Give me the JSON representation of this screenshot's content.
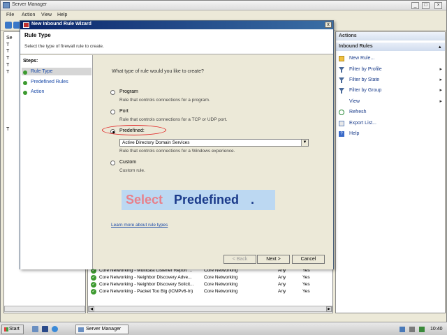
{
  "server_manager": {
    "title": "Server Manager",
    "menu": [
      "File",
      "Action",
      "View",
      "Help"
    ],
    "tree_fragments": [
      "Se",
      "T",
      "T",
      "T",
      "T",
      "T",
      "T"
    ],
    "list_rows": [
      {
        "name": "Core Networking - Multicast Listener Report ...",
        "group": "Core Networking",
        "profile": "Any",
        "enabled": "Yes"
      },
      {
        "name": "Core Networking - Neighbor Discovery Adve...",
        "group": "Core Networking",
        "profile": "Any",
        "enabled": "Yes"
      },
      {
        "name": "Core Networking - Neighbor Discovery Solicit...",
        "group": "Core Networking",
        "profile": "Any",
        "enabled": "Yes"
      },
      {
        "name": "Core Networking - Packet Too Big (ICMPv6-In)",
        "group": "Core Networking",
        "profile": "Any",
        "enabled": "Yes"
      }
    ]
  },
  "actions": {
    "title": "Actions",
    "section": "Inbound Rules",
    "items": [
      {
        "label": "New Rule...",
        "icon": "new-rule-icon",
        "submenu": false
      },
      {
        "label": "Filter by Profile",
        "icon": "filter-icon",
        "submenu": true
      },
      {
        "label": "Filter by State",
        "icon": "filter-icon",
        "submenu": true
      },
      {
        "label": "Filter by Group",
        "icon": "filter-icon",
        "submenu": true
      },
      {
        "label": "View",
        "icon": "",
        "submenu": true
      },
      {
        "label": "Refresh",
        "icon": "refresh-icon",
        "submenu": false
      },
      {
        "label": "Export List...",
        "icon": "export-icon",
        "submenu": false
      },
      {
        "label": "Help",
        "icon": "help-icon",
        "submenu": false
      }
    ]
  },
  "wizard": {
    "title": "New Inbound Rule Wizard",
    "close": "x",
    "heading": "Rule Type",
    "subheading": "Select the type of firewall rule to create.",
    "steps_label": "Steps:",
    "steps": [
      "Rule Type",
      "Predefined Rules",
      "Action"
    ],
    "question": "What type of rule would you like to create?",
    "options": [
      {
        "label": "Program",
        "desc": "Rule that controls connections for a program."
      },
      {
        "label": "Port",
        "desc": "Rule that controls connections for a TCP or UDP port."
      },
      {
        "label": "Predefined:",
        "desc": "Rule that controls connections for a Windows experience."
      },
      {
        "label": "Custom",
        "desc": "Custom rule."
      }
    ],
    "selected_option": "Predefined:",
    "dropdown_value": "Active Directory Domain Services",
    "callout_word1": "Select",
    "callout_word2": "Predefined",
    "callout_dot": ".",
    "learn_link": "Learn more about rule types",
    "btn_back": "< Back",
    "btn_next": "Next >",
    "btn_cancel": "Cancel"
  },
  "taskbar": {
    "start": "Start",
    "task_item": "Server Manager",
    "time": "10:40"
  }
}
